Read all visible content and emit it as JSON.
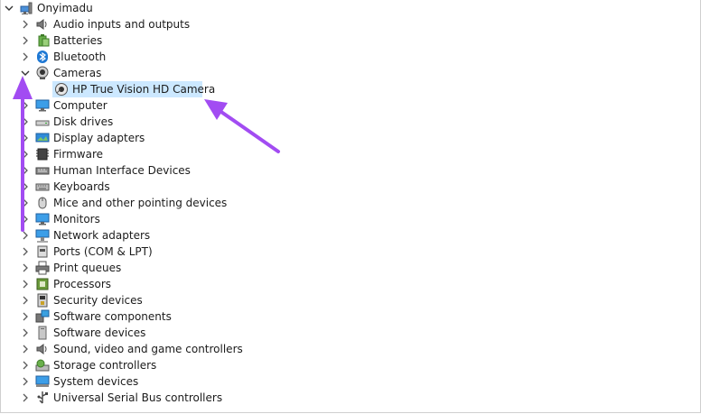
{
  "tree": {
    "root": {
      "label": "Onyimadu",
      "icon": "computer-root-icon"
    },
    "categories": [
      {
        "label": "Audio inputs and outputs",
        "icon": "speaker-icon"
      },
      {
        "label": "Batteries",
        "icon": "battery-icon"
      },
      {
        "label": "Bluetooth",
        "icon": "bluetooth-icon"
      },
      {
        "label": "Cameras",
        "icon": "camera-icon",
        "expanded": true,
        "children": [
          {
            "label": "HP True Vision HD Camera",
            "icon": "webcam-icon",
            "selected": true
          }
        ]
      },
      {
        "label": "Computer",
        "icon": "monitor-icon"
      },
      {
        "label": "Disk drives",
        "icon": "disk-icon"
      },
      {
        "label": "Display adapters",
        "icon": "display-adapter-icon"
      },
      {
        "label": "Firmware",
        "icon": "chip-icon"
      },
      {
        "label": "Human Interface Devices",
        "icon": "hid-icon"
      },
      {
        "label": "Keyboards",
        "icon": "keyboard-icon"
      },
      {
        "label": "Mice and other pointing devices",
        "icon": "mouse-icon"
      },
      {
        "label": "Monitors",
        "icon": "monitor-icon"
      },
      {
        "label": "Network adapters",
        "icon": "network-icon"
      },
      {
        "label": "Ports (COM & LPT)",
        "icon": "port-icon"
      },
      {
        "label": "Print queues",
        "icon": "printer-icon"
      },
      {
        "label": "Processors",
        "icon": "processor-icon"
      },
      {
        "label": "Security devices",
        "icon": "security-icon"
      },
      {
        "label": "Software components",
        "icon": "software-component-icon"
      },
      {
        "label": "Software devices",
        "icon": "software-device-icon"
      },
      {
        "label": "Sound, video and game controllers",
        "icon": "speaker-icon"
      },
      {
        "label": "Storage controllers",
        "icon": "storage-icon"
      },
      {
        "label": "System devices",
        "icon": "system-icon"
      },
      {
        "label": "Universal Serial Bus controllers",
        "icon": "usb-icon"
      }
    ]
  },
  "colors": {
    "selection": "#cce8ff",
    "annotation_arrow": "#a24cf2",
    "chevron": "#5a5a5a"
  }
}
